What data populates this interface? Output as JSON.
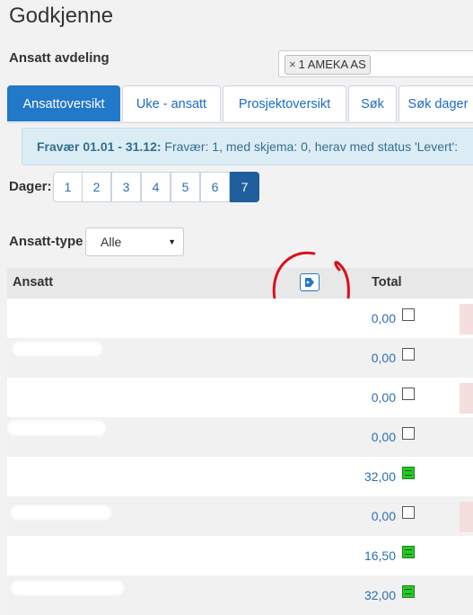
{
  "page": {
    "title": "Godkjenne"
  },
  "department": {
    "label": "Ansatt avdeling",
    "chip_remove": "×",
    "chip_value": "1 AMEKA AS"
  },
  "tabs": [
    {
      "label": "Ansattoversikt",
      "active": true
    },
    {
      "label": "Uke - ansatt",
      "active": false
    },
    {
      "label": "Prosjektoversikt",
      "active": false
    },
    {
      "label": "Søk",
      "active": false
    },
    {
      "label": "Søk dager",
      "active": false
    }
  ],
  "info": {
    "title": "Fravær 01.01 - 31.12:",
    "text": "Fravær: 1, med skjema: 0, herav med status 'Levert':"
  },
  "days": {
    "label": "Dager:",
    "pages": [
      "1",
      "2",
      "3",
      "4",
      "5",
      "6",
      "7"
    ],
    "active": "7"
  },
  "employee_type": {
    "label": "Ansatt-type",
    "value": "Alle"
  },
  "table": {
    "headers": {
      "employee": "Ansatt",
      "total": "Total"
    },
    "tag_icon": "tag-icon",
    "rows": [
      {
        "name_fragment": "",
        "total": "0,00",
        "note": "empty-note-icon"
      },
      {
        "name_fragment": "",
        "total": "0,00",
        "note": "empty-note-icon"
      },
      {
        "name_fragment": "",
        "total": "0,00",
        "note": "empty-note-icon"
      },
      {
        "name_fragment": "",
        "total": "0,00",
        "note": "empty-note-icon"
      },
      {
        "name_fragment": "",
        "total": "32,00",
        "note": "filled-note-icon"
      },
      {
        "name_fragment": "",
        "total": "0,00",
        "note": "empty-note-icon"
      },
      {
        "name_fragment": "",
        "total": "16,50",
        "note": "filled-note-icon"
      },
      {
        "name_fragment": "",
        "total": "32,00",
        "note": "filled-note-icon"
      }
    ]
  },
  "colors": {
    "primary": "#2278c9",
    "annotation": "#d9111a",
    "note_green": "#22cc22",
    "info_bg": "#dcecf5"
  }
}
